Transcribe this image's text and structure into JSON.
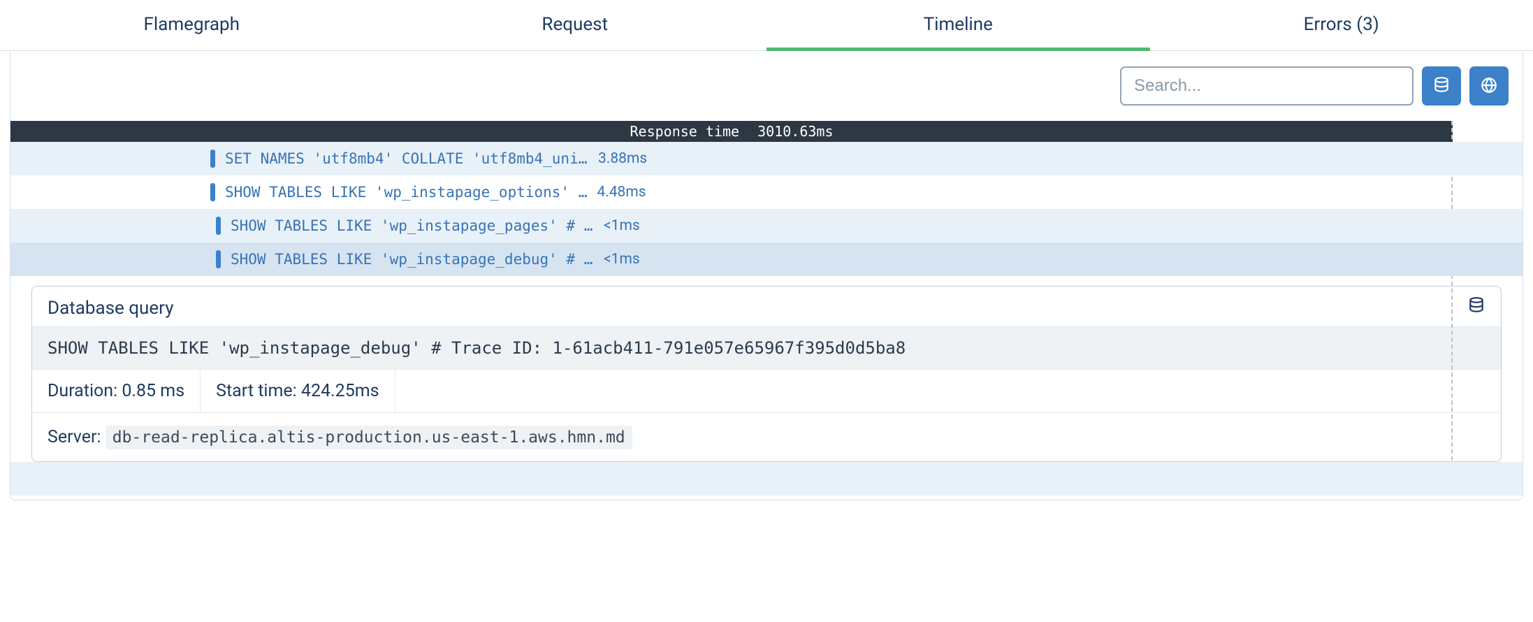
{
  "tabs": {
    "flamegraph": "Flamegraph",
    "request": "Request",
    "timeline": "Timeline",
    "errors": "Errors (3)"
  },
  "search": {
    "placeholder": "Search..."
  },
  "response": {
    "label": "Response time",
    "value": "3010.63ms"
  },
  "rows": [
    {
      "query": "SET NAMES 'utf8mb4' COLLATE 'utf8mb4_unic…",
      "duration": "3.88ms"
    },
    {
      "query": "SHOW TABLES LIKE 'wp_instapage_options' …",
      "duration": "4.48ms"
    },
    {
      "query": "SHOW TABLES LIKE 'wp_instapage_pages' # Tra…",
      "duration": "<1ms"
    },
    {
      "query": "SHOW TABLES LIKE 'wp_instapage_debug' # Tra…",
      "duration": "<1ms"
    }
  ],
  "detail": {
    "title": "Database query",
    "full_query": "SHOW TABLES LIKE 'wp_instapage_debug' # Trace ID: 1-61acb411-791e057e65967f395d0d5ba8",
    "duration_label": "Duration: 0.85 ms",
    "start_label": "Start time: 424.25ms",
    "server_label": "Server:",
    "server_value": "db-read-replica.altis-production.us-east-1.aws.hmn.md"
  }
}
